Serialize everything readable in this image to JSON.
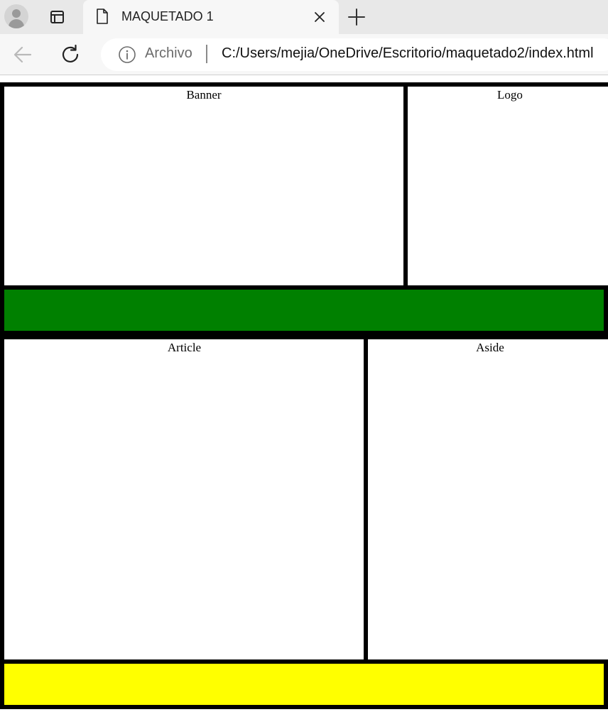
{
  "browser": {
    "tab_title": "MAQUETADO 1",
    "scheme_label": "Archivo",
    "url": "C:/Users/mejia/OneDrive/Escritorio/maquetado2/index.html",
    "icons": {
      "profile": "profile-icon",
      "tab_actions": "tab-actions-icon",
      "page": "page-icon",
      "close": "close-icon",
      "new_tab": "plus-icon",
      "back": "back-arrow-icon",
      "reload": "reload-icon",
      "info": "info-icon"
    }
  },
  "page": {
    "banner_label": "Banner",
    "logo_label": "Logo",
    "article_label": "Article",
    "aside_label": "Aside",
    "nav_color": "#008000",
    "footer_color": "#ffff00",
    "border_color": "#000000"
  }
}
